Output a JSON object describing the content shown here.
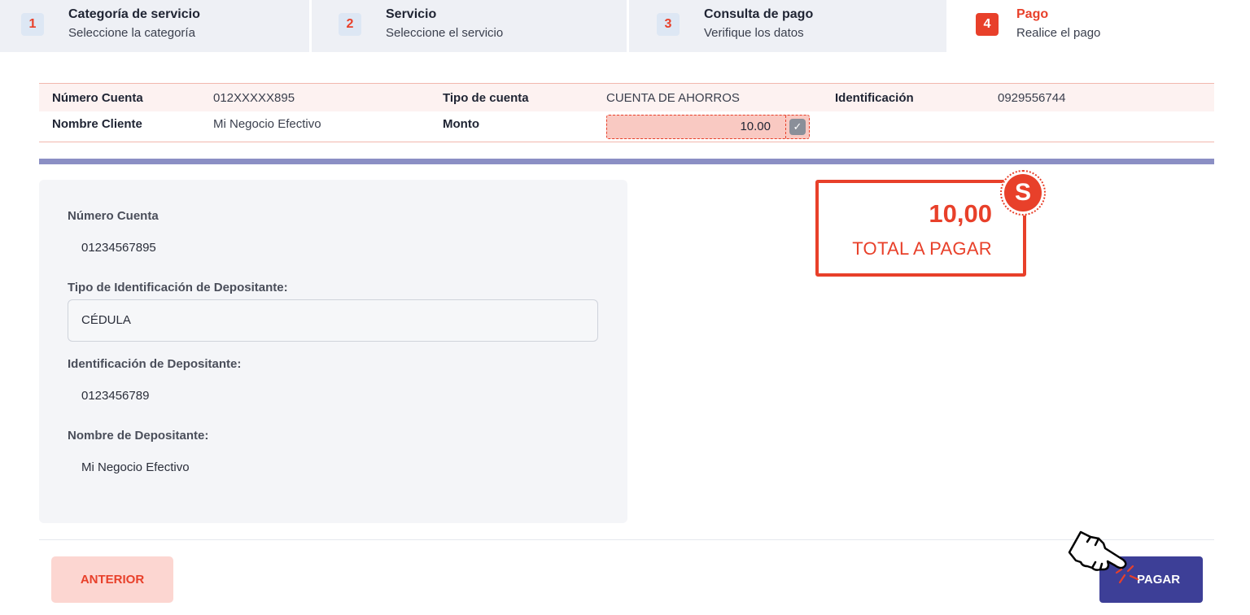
{
  "stepper": [
    {
      "num": "1",
      "title": "Categoría de servicio",
      "subtitle": "Seleccione la categoría"
    },
    {
      "num": "2",
      "title": "Servicio",
      "subtitle": "Seleccione el servicio"
    },
    {
      "num": "3",
      "title": "Consulta de pago",
      "subtitle": "Verifique los datos"
    },
    {
      "num": "4",
      "title": "Pago",
      "subtitle": "Realice el pago"
    }
  ],
  "summary": {
    "numero_cuenta_label": "Número Cuenta",
    "numero_cuenta_value": "012XXXXX895",
    "tipo_cuenta_label": "Tipo de cuenta",
    "tipo_cuenta_value": "CUENTA DE AHORROS",
    "identificacion_label": "Identificación",
    "identificacion_value": "0929556744",
    "nombre_cliente_label": "Nombre Cliente",
    "nombre_cliente_value": "Mi Negocio Efectivo",
    "monto_label": "Monto",
    "monto_value": "10.00"
  },
  "form": {
    "numero_cuenta_label": "Número Cuenta",
    "numero_cuenta_value": "01234567895",
    "tipo_id_label": "Tipo de Identificación de Depositante:",
    "tipo_id_value": "CÉDULA",
    "id_depositante_label": "Identificación de Depositante:",
    "id_depositante_value": "0123456789",
    "nombre_depositante_label": "Nombre de Depositante:",
    "nombre_depositante_value": "Mi Negocio Efectivo"
  },
  "total": {
    "amount": "10,00",
    "label": "TOTAL A PAGAR",
    "icon": "dollar-icon",
    "icon_glyph": "S"
  },
  "buttons": {
    "prev_label": "ANTERIOR",
    "pay_label": "PAGAR"
  },
  "colors": {
    "accent": "#e8402a",
    "primary": "#3d3f97",
    "divider": "#8b8fc4"
  }
}
